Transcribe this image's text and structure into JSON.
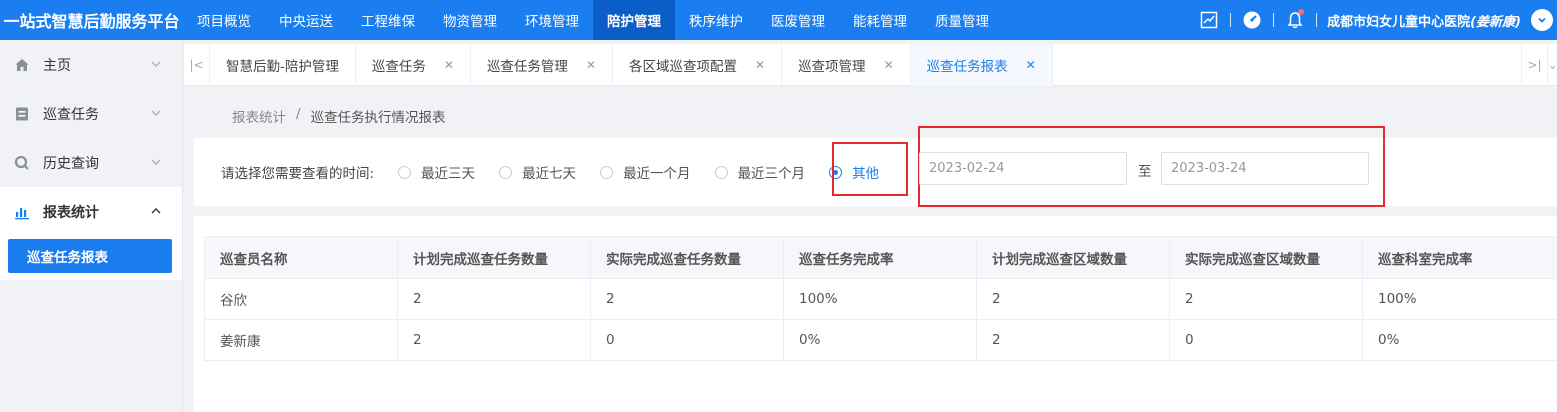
{
  "app": {
    "brand": "一站式智慧后勤服务平台",
    "nav": [
      {
        "label": "项目概览",
        "active": false
      },
      {
        "label": "中央运送",
        "active": false
      },
      {
        "label": "工程维保",
        "active": false
      },
      {
        "label": "物资管理",
        "active": false
      },
      {
        "label": "环境管理",
        "active": false
      },
      {
        "label": "陪护管理",
        "active": true
      },
      {
        "label": "秩序维护",
        "active": false
      },
      {
        "label": "医废管理",
        "active": false
      },
      {
        "label": "能耗管理",
        "active": false
      },
      {
        "label": "质量管理",
        "active": false
      }
    ],
    "org_name": "成都市妇女儿童中心医院",
    "user_name": "(姜新康)",
    "accent_color": "#1a7ef0"
  },
  "sidebar": {
    "items": [
      {
        "label": "主页",
        "icon": "home-icon"
      },
      {
        "label": "巡查任务",
        "icon": "task-icon"
      },
      {
        "label": "历史查询",
        "icon": "history-icon"
      },
      {
        "label": "报表统计",
        "icon": "chart-icon"
      }
    ],
    "sub_item": "巡查任务报表"
  },
  "tabs": [
    {
      "label": "智慧后勤-陪护管理",
      "closable": false,
      "active": false
    },
    {
      "label": "巡查任务",
      "closable": true,
      "active": false
    },
    {
      "label": "巡查任务管理",
      "closable": true,
      "active": false
    },
    {
      "label": "各区域巡查项配置",
      "closable": true,
      "active": false
    },
    {
      "label": "巡查项管理",
      "closable": true,
      "active": false
    },
    {
      "label": "巡查任务报表",
      "closable": true,
      "active": true
    }
  ],
  "breadcrumb": {
    "parent": "报表统计",
    "separator": "/",
    "current": "巡查任务执行情况报表"
  },
  "filter": {
    "label": "请选择您需要查看的时间:",
    "options": [
      "最近三天",
      "最近七天",
      "最近一个月",
      "最近三个月",
      "其他"
    ],
    "selected": "其他",
    "start_date": "2023-02-24",
    "to_label": "至",
    "end_date": "2023-03-24"
  },
  "table": {
    "headers": [
      "巡查员名称",
      "计划完成巡查任务数量",
      "实际完成巡查任务数量",
      "巡查任务完成率",
      "计划完成巡查区域数量",
      "实际完成巡查区域数量",
      "巡查科室完成率"
    ],
    "rows": [
      [
        "谷欣",
        "2",
        "2",
        "100%",
        "2",
        "2",
        "100%"
      ],
      [
        "姜新康",
        "2",
        "0",
        "0%",
        "2",
        "0",
        "0%"
      ]
    ]
  }
}
